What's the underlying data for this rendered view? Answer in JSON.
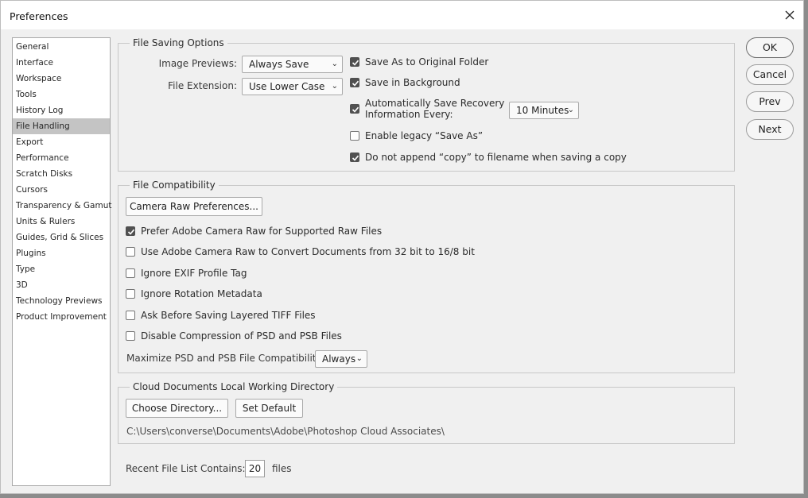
{
  "window": {
    "title": "Preferences"
  },
  "sidebar": {
    "items": [
      {
        "label": "General"
      },
      {
        "label": "Interface"
      },
      {
        "label": "Workspace"
      },
      {
        "label": "Tools"
      },
      {
        "label": "History Log"
      },
      {
        "label": "File Handling",
        "selected": true
      },
      {
        "label": "Export"
      },
      {
        "label": "Performance"
      },
      {
        "label": "Scratch Disks"
      },
      {
        "label": "Cursors"
      },
      {
        "label": "Transparency & Gamut"
      },
      {
        "label": "Units & Rulers"
      },
      {
        "label": "Guides, Grid & Slices"
      },
      {
        "label": "Plugins"
      },
      {
        "label": "Type"
      },
      {
        "label": "3D"
      },
      {
        "label": "Technology Previews"
      },
      {
        "label": "Product Improvement"
      }
    ]
  },
  "file_saving": {
    "title": "File Saving Options",
    "image_previews_label": "Image Previews:",
    "image_previews_value": "Always Save",
    "file_extension_label": "File Extension:",
    "file_extension_value": "Use Lower Case",
    "save_as_original": {
      "label": "Save As to Original Folder",
      "checked": true
    },
    "save_in_background": {
      "label": "Save in Background",
      "checked": true
    },
    "auto_save": {
      "label_line1": "Automatically Save Recovery",
      "label_line2": "Information Every:",
      "checked": true
    },
    "auto_save_interval": "10 Minutes",
    "legacy_save_as": {
      "label": "Enable legacy “Save As”",
      "checked": false
    },
    "no_copy_append": {
      "label": "Do not append “copy” to filename when saving a copy",
      "checked": true
    }
  },
  "file_compat": {
    "title": "File Compatibility",
    "camera_raw_button": "Camera Raw Preferences...",
    "prefer_acr": {
      "label": "Prefer Adobe Camera Raw for Supported Raw Files",
      "checked": true
    },
    "acr_convert": {
      "label": "Use Adobe Camera Raw to Convert Documents from 32 bit to 16/8 bit",
      "checked": false
    },
    "ignore_exif": {
      "label": "Ignore EXIF Profile Tag",
      "checked": false
    },
    "ignore_rotation": {
      "label": "Ignore Rotation Metadata",
      "checked": false
    },
    "ask_tiff": {
      "label": "Ask Before Saving Layered TIFF Files",
      "checked": false
    },
    "disable_compression": {
      "label": "Disable Compression of PSD and PSB Files",
      "checked": false
    },
    "maximize_label": "Maximize PSD and PSB File Compatibility:",
    "maximize_value": "Always"
  },
  "cloud_docs": {
    "title": "Cloud Documents Local Working Directory",
    "choose_button": "Choose Directory...",
    "default_button": "Set Default",
    "path": "C:\\Users\\converse\\Documents\\Adobe\\Photoshop Cloud Associates\\"
  },
  "recent_files": {
    "label": "Recent File List Contains:",
    "value": "20",
    "suffix": "files"
  },
  "buttons": {
    "ok": "OK",
    "cancel": "Cancel",
    "prev": "Prev",
    "next": "Next"
  }
}
